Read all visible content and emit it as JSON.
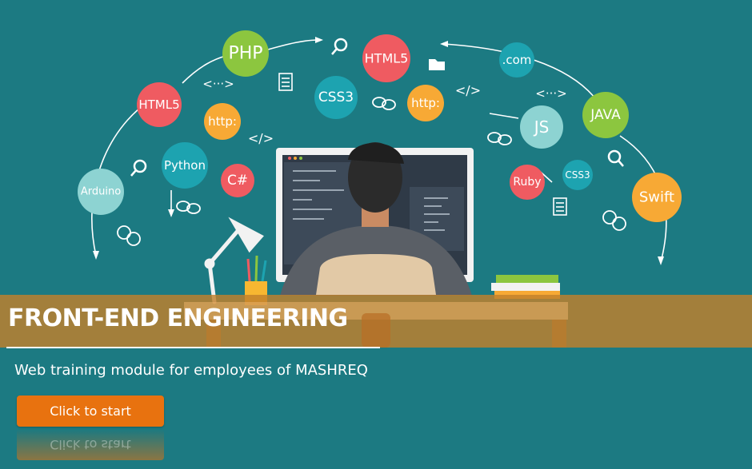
{
  "hero": {
    "bubbles": {
      "php": "PHP",
      "html5_top": "HTML5",
      "html5_left": "HTML5",
      "css3_center": "CSS3",
      "http_left": "http:",
      "http_center": "http:",
      "python": "Python",
      "csharp": "C#",
      "arduino": "Arduino",
      "dotcom": ".com",
      "java": "JAVA",
      "js": "JS",
      "ruby": "Ruby",
      "css3_right": "CSS3",
      "swift": "Swift"
    },
    "code_marks": {
      "ellipsis_left": "<···>",
      "slash_left": "</>",
      "slash_right": "</>",
      "ellipsis_right": "<···>"
    }
  },
  "banner": {
    "title": "FRONT-END ENGINEERING",
    "subtitle": "Web training module for employees of MASHREQ"
  },
  "actions": {
    "start_label": "Click to start"
  },
  "colors": {
    "background": "#1c7a82",
    "band": "#c1802c",
    "button": "#e8720f",
    "bubble_red": "#ef5b61",
    "bubble_green": "#8cc63f",
    "bubble_orange": "#f7a935",
    "bubble_teal": "#1da3b0",
    "bubble_light": "#8dd3d2"
  }
}
